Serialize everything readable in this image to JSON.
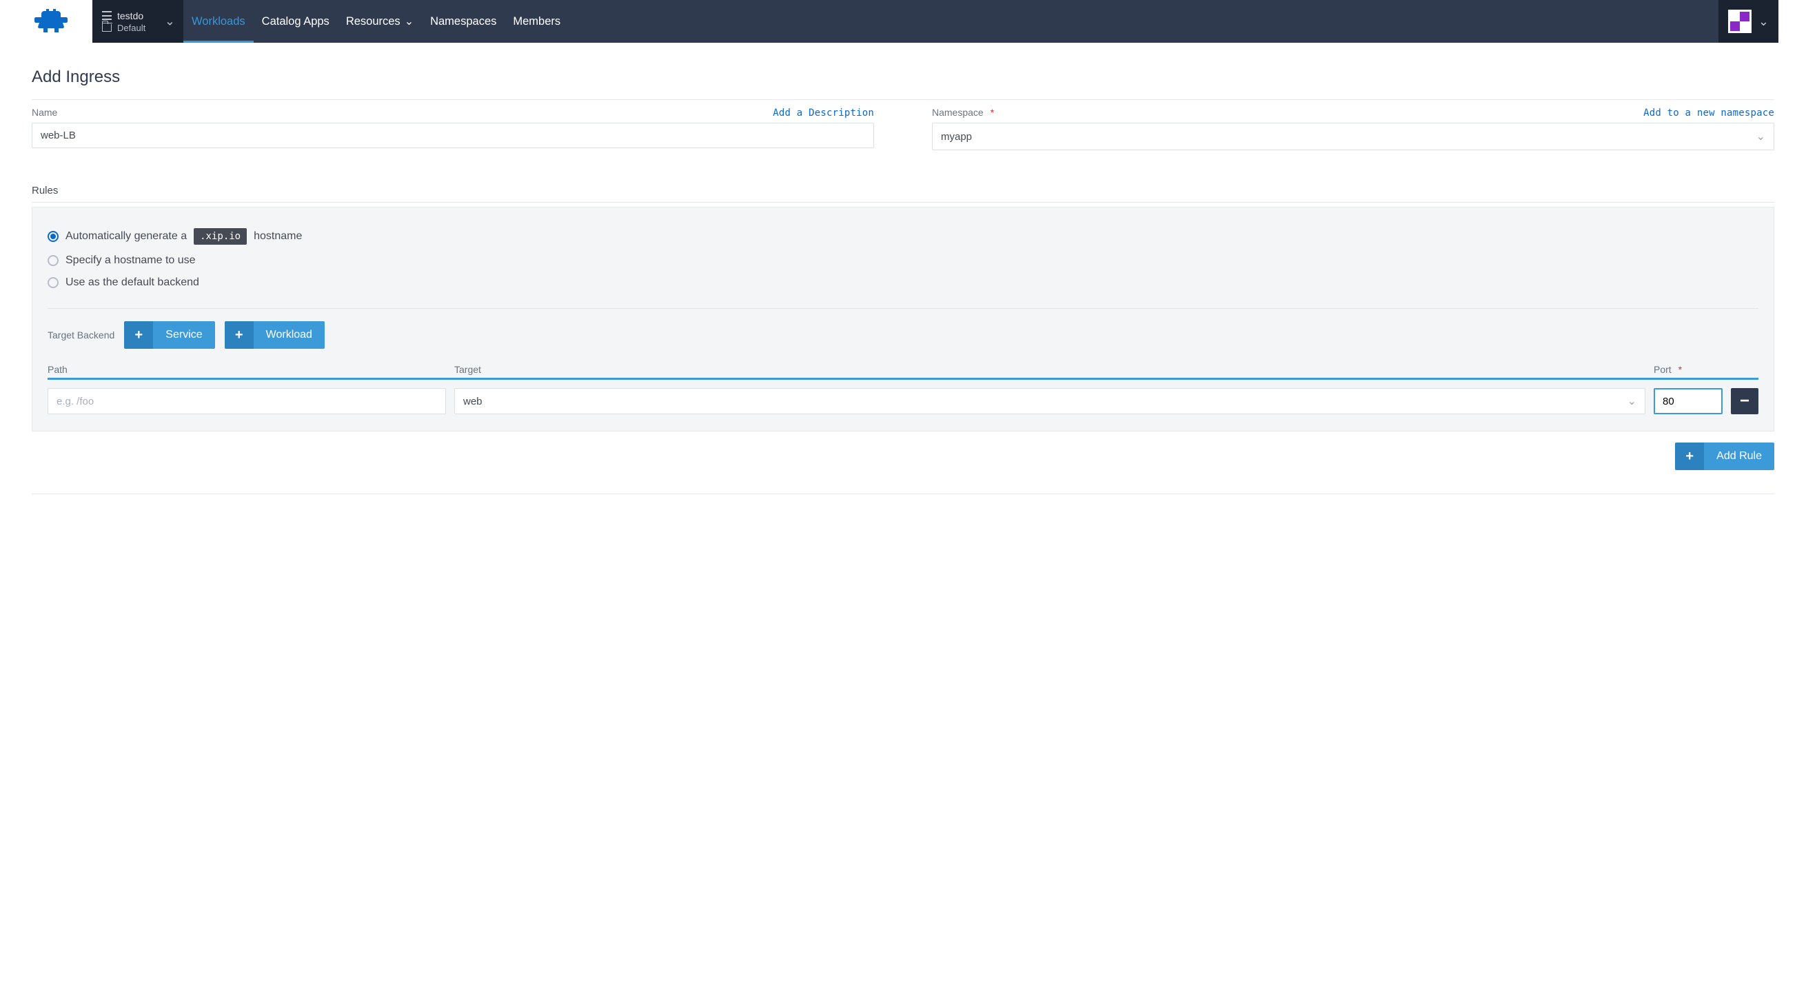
{
  "nav": {
    "cluster_name": "testdo",
    "project_name": "Default",
    "items": [
      {
        "label": "Workloads",
        "active": true,
        "has_chevron": false
      },
      {
        "label": "Catalog Apps",
        "active": false,
        "has_chevron": false
      },
      {
        "label": "Resources",
        "active": false,
        "has_chevron": true
      },
      {
        "label": "Namespaces",
        "active": false,
        "has_chevron": false
      },
      {
        "label": "Members",
        "active": false,
        "has_chevron": false
      }
    ]
  },
  "page": {
    "title": "Add Ingress",
    "name_label": "Name",
    "add_description_link": "Add a Description",
    "name_value": "web-LB",
    "namespace_label": "Namespace",
    "add_namespace_link": "Add to a new namespace",
    "namespace_value": "myapp"
  },
  "rules": {
    "section_label": "Rules",
    "options": {
      "auto_prefix": "Automatically generate a",
      "auto_code": ".xip.io",
      "auto_suffix": "hostname",
      "specify": "Specify a hostname to use",
      "default_backend": "Use as the default backend"
    },
    "selected_option": 0,
    "target_backend_label": "Target Backend",
    "service_btn": "Service",
    "workload_btn": "Workload",
    "columns": {
      "path": "Path",
      "target": "Target",
      "port": "Port"
    },
    "row": {
      "path_placeholder": "e.g. /foo",
      "path_value": "",
      "target_value": "web",
      "port_value": "80"
    },
    "add_rule_btn": "Add Rule"
  }
}
